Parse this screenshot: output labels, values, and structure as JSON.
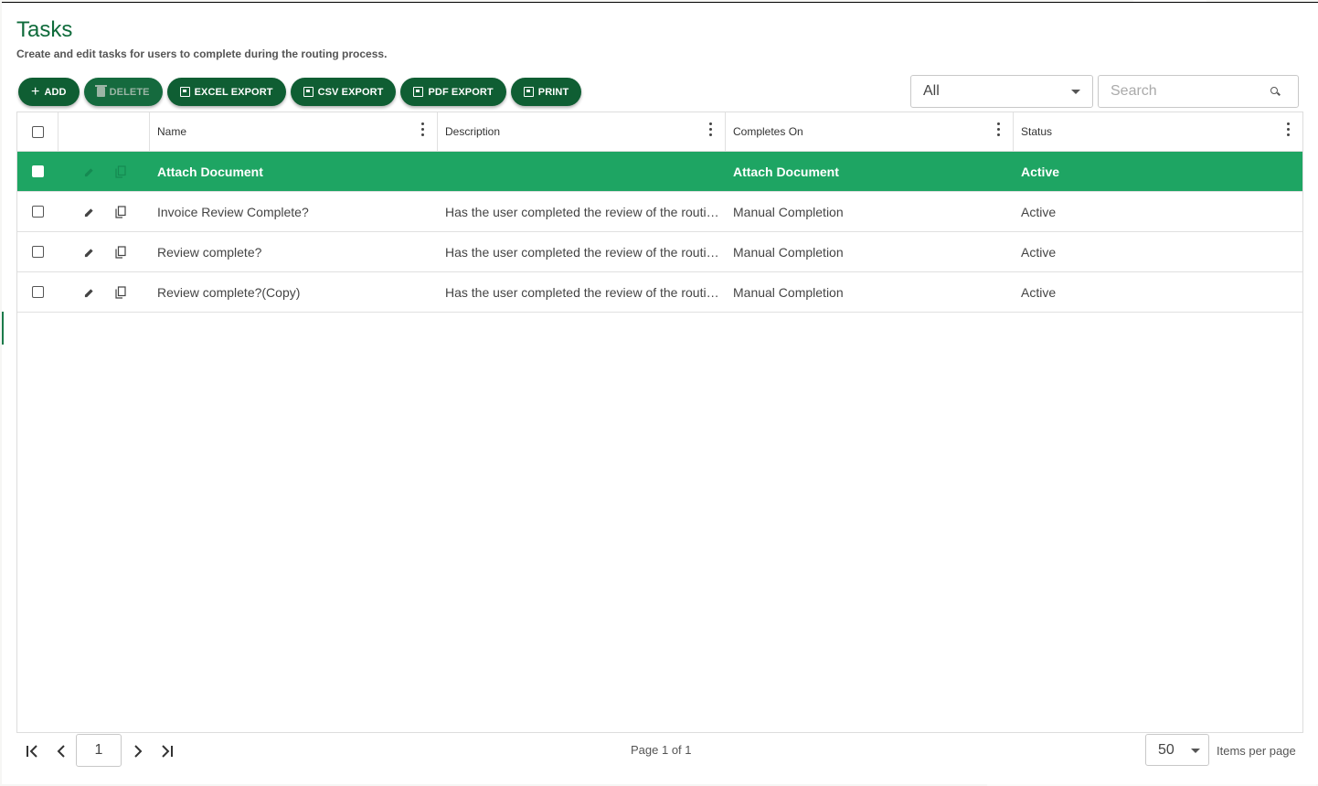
{
  "header": {
    "title": "Tasks",
    "subtitle": "Create and edit tasks for users to complete during the routing process."
  },
  "toolbar": {
    "add_label": "ADD",
    "delete_label": "DELETE",
    "excel_label": "EXCEL EXPORT",
    "csv_label": "CSV EXPORT",
    "pdf_label": "PDF EXPORT",
    "print_label": "PRINT"
  },
  "filter": {
    "selected": "All"
  },
  "search": {
    "placeholder": "Search"
  },
  "table": {
    "columns": {
      "name": "Name",
      "description": "Description",
      "completes_on": "Completes On",
      "status": "Status"
    },
    "rows": [
      {
        "name": "Attach Document",
        "description": "",
        "completes_on": "Attach Document",
        "status": "Active",
        "selected": true
      },
      {
        "name": "Invoice Review Complete?",
        "description": "Has the user completed the review of the routing item?",
        "completes_on": "Manual Completion",
        "status": "Active"
      },
      {
        "name": "Review complete?",
        "description": "Has the user completed the review of the routing item?",
        "completes_on": "Manual Completion",
        "status": "Active"
      },
      {
        "name": "Review complete?(Copy)",
        "description": "Has the user completed the review of the routing item?",
        "completes_on": "Manual Completion",
        "status": "Active"
      }
    ]
  },
  "pager": {
    "page": "1",
    "info": "Page 1 of 1",
    "per_page": "50",
    "per_page_label": "Items per page"
  },
  "colors": {
    "primary": "#0f5e33",
    "selected_row": "#1ea563",
    "title": "#0f6b3b"
  }
}
